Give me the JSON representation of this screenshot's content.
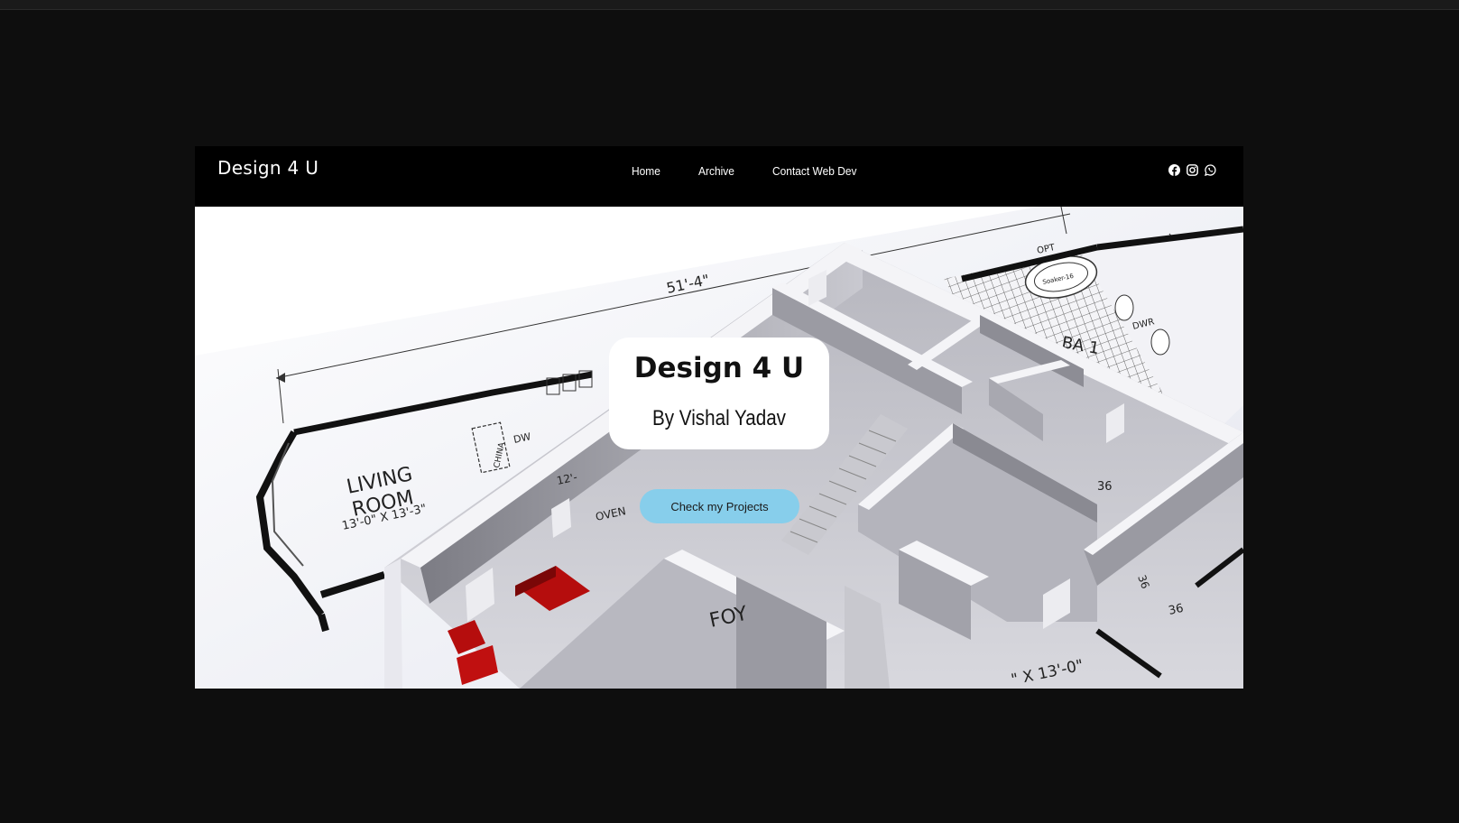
{
  "header": {
    "brand": "Design 4 U",
    "nav": [
      {
        "label": "Home"
      },
      {
        "label": "Archive"
      },
      {
        "label": "Contact Web Dev"
      }
    ],
    "social_icons": [
      "facebook-icon",
      "instagram-icon",
      "whatsapp-icon"
    ]
  },
  "hero": {
    "title": "Design 4 U",
    "subtitle": "By Vishal Yadav",
    "cta_label": "Check my Projects",
    "background": {
      "dimension_top": "51'-4\"",
      "room_label_line1": "LIVING",
      "room_label_line2": "ROOM",
      "room_size": "13'-0\" X 13'-3\"",
      "label_china": "CHINA",
      "label_dw": "DW",
      "label_oven": "OVEN",
      "label_opt": "OPT",
      "label_ba": "BA 1",
      "label_dwr": "DWR",
      "label_soaker": "Soaker-16",
      "label_fo": "FOY",
      "label_size_bottom": "\" X 13'-0\"",
      "label_12": "12'-",
      "label_36a": "36",
      "label_36b": "36",
      "label_36c": "36"
    }
  },
  "colors": {
    "page_background": "#0e0e0e",
    "navbar": "#000000",
    "card": "#ffffff",
    "cta": "#87ceeb",
    "furniture": "#b50d0d"
  }
}
